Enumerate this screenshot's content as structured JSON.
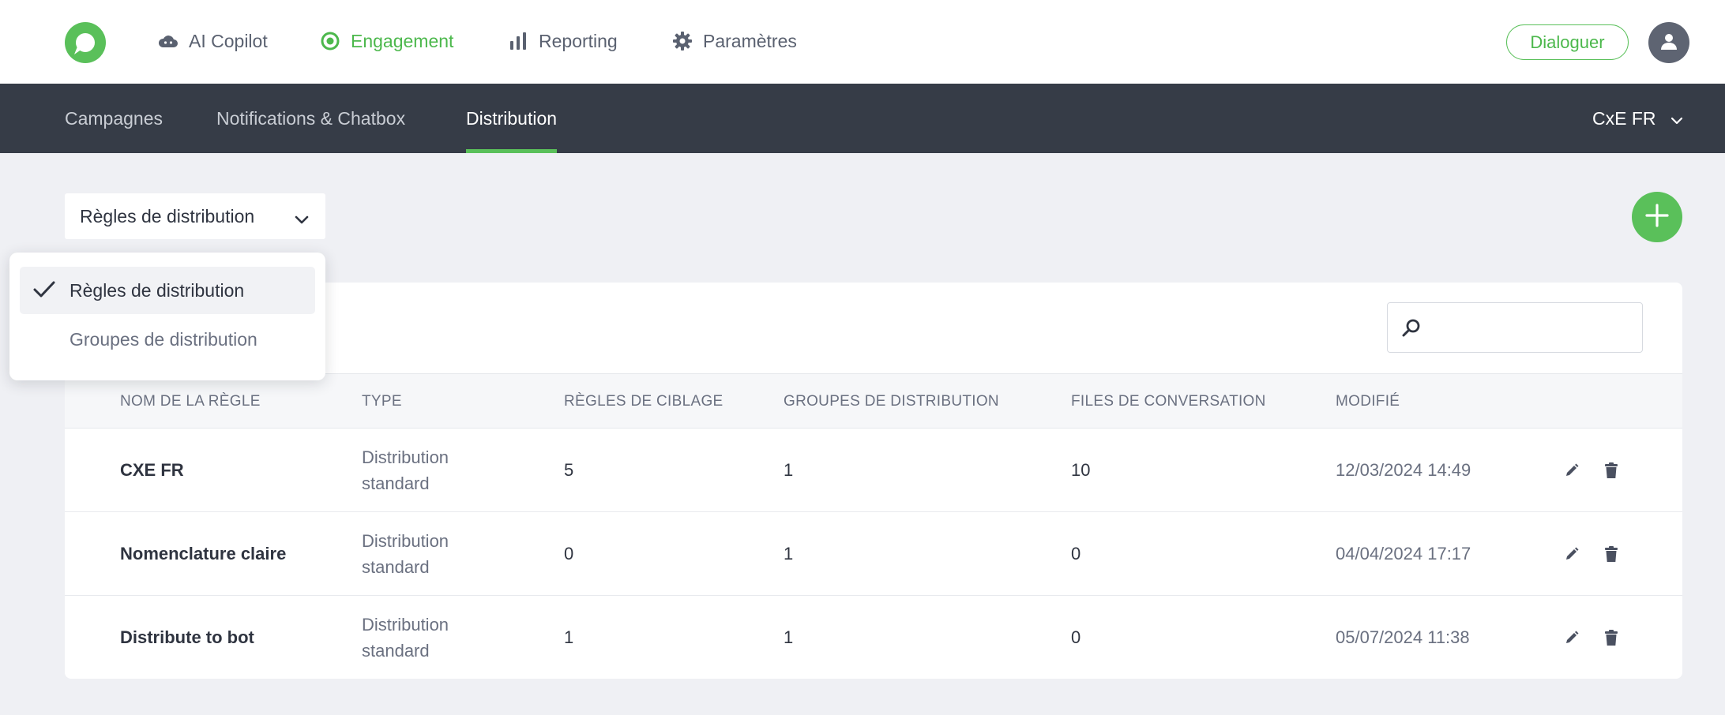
{
  "topnav": {
    "items": [
      {
        "label": "AI Copilot",
        "icon": "cloud-icon",
        "active": false
      },
      {
        "label": "Engagement",
        "icon": "target-icon",
        "active": true
      },
      {
        "label": "Reporting",
        "icon": "bar-chart-icon",
        "active": false
      },
      {
        "label": "Paramètres",
        "icon": "gear-icon",
        "active": false
      }
    ],
    "dialoguer_label": "Dialoguer"
  },
  "subnav": {
    "tabs": [
      {
        "label": "Campagnes",
        "active": false
      },
      {
        "label": "Notifications & Chatbox",
        "active": false
      },
      {
        "label": "Distribution",
        "active": true
      }
    ],
    "org_label": "CxE FR"
  },
  "select": {
    "value": "Règles de distribution",
    "options": [
      {
        "label": "Règles de distribution",
        "selected": true
      },
      {
        "label": "Groupes de distribution",
        "selected": false
      }
    ]
  },
  "search": {
    "placeholder": "",
    "value": ""
  },
  "table": {
    "headers": [
      "NOM DE LA RÈGLE",
      "TYPE",
      "RÈGLES DE CIBLAGE",
      "GROUPES DE DISTRIBUTION",
      "FILES DE CONVERSATION",
      "MODIFIÉ"
    ],
    "rows": [
      {
        "name": "CXE FR",
        "type": "Distribution standard",
        "targeting": "5",
        "groups": "1",
        "queues": "10",
        "modified": "12/03/2024 14:49"
      },
      {
        "name": "Nomenclature claire",
        "type": "Distribution standard",
        "targeting": "0",
        "groups": "1",
        "queues": "0",
        "modified": "04/04/2024 17:17"
      },
      {
        "name": "Distribute to bot",
        "type": "Distribution standard",
        "targeting": "1",
        "groups": "1",
        "queues": "0",
        "modified": "05/07/2024 11:38"
      }
    ]
  },
  "colors": {
    "accent": "#5ac05a",
    "subnav_bg": "#363c47",
    "page_bg": "#eff0f4"
  }
}
